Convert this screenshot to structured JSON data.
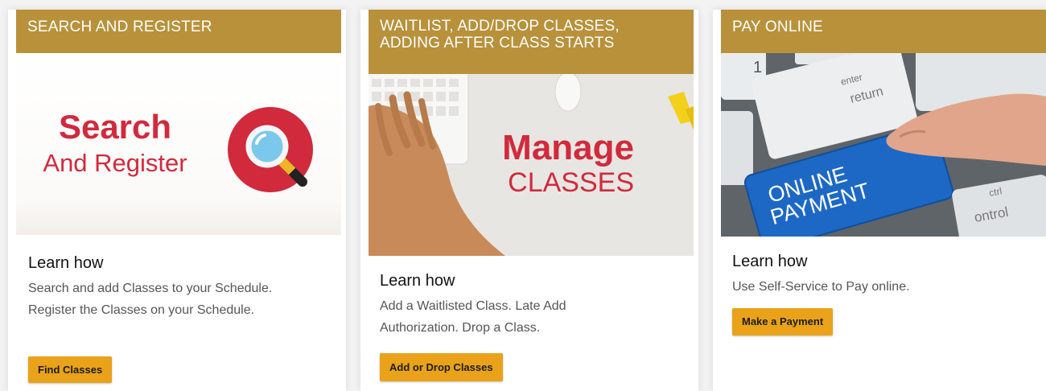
{
  "cards": [
    {
      "header": "SEARCH AND REGISTER",
      "image_title": "Search",
      "image_subtitle": "And Register",
      "image_icon": "magnifier-icon",
      "learn": "Learn how",
      "desc_line1": "Search and add Classes to your Schedule.",
      "desc_line2": "Register the Classes on your Schedule.",
      "button": "Find Classes"
    },
    {
      "header_line1": "WAITLIST, ADD/DROP CLASSES,",
      "header_line2": "ADDING AFTER CLASS STARTS",
      "image_title": "Manage",
      "image_subtitle": "CLASSES",
      "learn": "Learn how",
      "desc_line1": "Add a Waitlisted Class. Late Add",
      "desc_line2": "Authorization. Drop a Class.",
      "button": "Add or Drop Classes"
    },
    {
      "header": "PAY ONLINE",
      "image_key_top": "enter",
      "image_key_return": "return",
      "image_key_line1": "ONLINE",
      "image_key_line2": "PAYMENT",
      "image_key_ctrl1": "ctrl",
      "image_key_ctrl2": "ontrol",
      "image_key_one": "1",
      "learn": "Learn how",
      "desc_line1": "Use Self-Service to Pay online.",
      "button": "Make a Payment"
    }
  ],
  "colors": {
    "header_bg": "#b8913a",
    "button_bg": "#e9a219",
    "brand_red": "#d12a3d"
  }
}
